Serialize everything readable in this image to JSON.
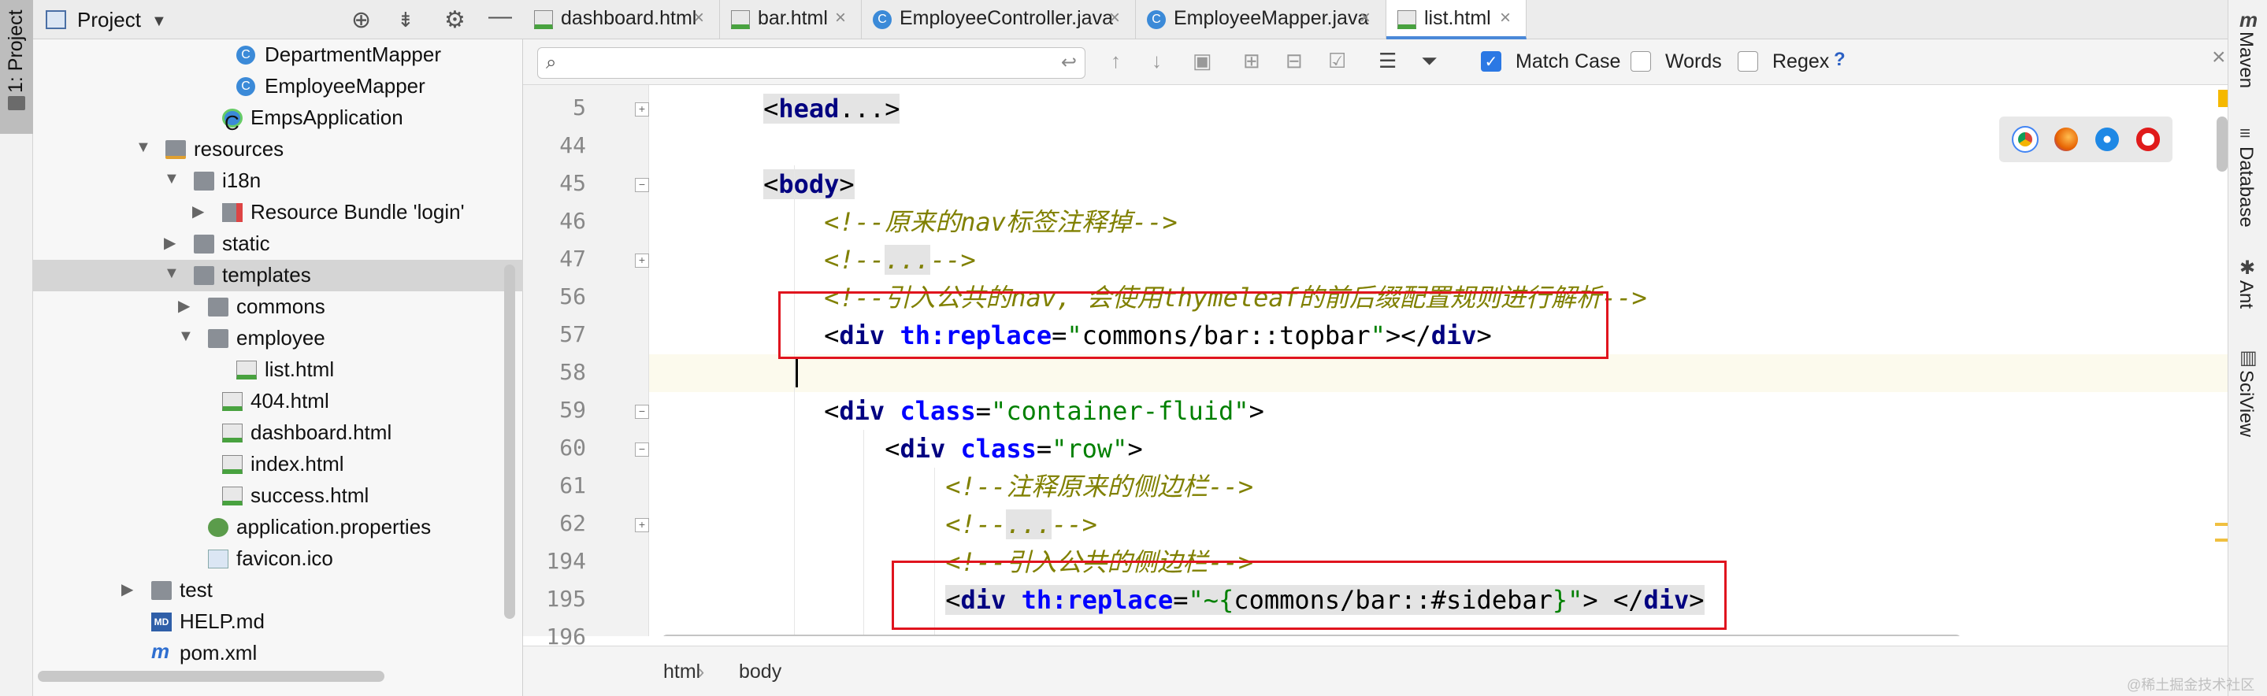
{
  "left_strip": {
    "label": "1: Project"
  },
  "project_panel": {
    "title": "Project",
    "tree": [
      {
        "label": "DepartmentMapper",
        "indent": 9,
        "icon": "class",
        "arrow": ""
      },
      {
        "label": "EmployeeMapper",
        "indent": 9,
        "icon": "class",
        "arrow": ""
      },
      {
        "label": "EmpsApplication",
        "indent": 8,
        "icon": "app",
        "arrow": ""
      },
      {
        "label": "resources",
        "indent": 4,
        "icon": "folder-res",
        "arrow": "▼"
      },
      {
        "label": "i18n",
        "indent": 6,
        "icon": "folder",
        "arrow": "▼"
      },
      {
        "label": "Resource Bundle 'login'",
        "indent": 8,
        "icon": "bundle",
        "arrow": "▶"
      },
      {
        "label": "static",
        "indent": 6,
        "icon": "folder",
        "arrow": "▶"
      },
      {
        "label": "templates",
        "indent": 6,
        "icon": "folder",
        "arrow": "▼",
        "selected": true
      },
      {
        "label": "commons",
        "indent": 7,
        "icon": "folder",
        "arrow": "▶"
      },
      {
        "label": "employee",
        "indent": 7,
        "icon": "folder",
        "arrow": "▼"
      },
      {
        "label": "list.html",
        "indent": 9,
        "icon": "html",
        "arrow": ""
      },
      {
        "label": "404.html",
        "indent": 8,
        "icon": "html",
        "arrow": ""
      },
      {
        "label": "dashboard.html",
        "indent": 8,
        "icon": "html",
        "arrow": ""
      },
      {
        "label": "index.html",
        "indent": 8,
        "icon": "html",
        "arrow": ""
      },
      {
        "label": "success.html",
        "indent": 8,
        "icon": "html",
        "arrow": ""
      },
      {
        "label": "application.properties",
        "indent": 7,
        "icon": "props",
        "arrow": ""
      },
      {
        "label": "favicon.ico",
        "indent": 7,
        "icon": "ico",
        "arrow": ""
      },
      {
        "label": "test",
        "indent": 3,
        "icon": "folder",
        "arrow": "▶"
      },
      {
        "label": "HELP.md",
        "indent": 3,
        "icon": "md",
        "arrow": ""
      },
      {
        "label": "pom.xml",
        "indent": 3,
        "icon": "maven",
        "arrow": ""
      }
    ]
  },
  "tabs": [
    {
      "label": "dashboard.html",
      "icon": "html",
      "active": false
    },
    {
      "label": "bar.html",
      "icon": "html",
      "active": false
    },
    {
      "label": "EmployeeController.java",
      "icon": "class",
      "active": false
    },
    {
      "label": "EmployeeMapper.java",
      "icon": "class",
      "active": false
    },
    {
      "label": "list.html",
      "icon": "html",
      "active": true
    }
  ],
  "search": {
    "value": "",
    "match_case_label": "Match Case",
    "match_case_checked": true,
    "words_label": "Words",
    "words_checked": false,
    "regex_label": "Regex",
    "regex_checked": false,
    "help_label": "?"
  },
  "editor": {
    "line_numbers": [
      "5",
      "44",
      "45",
      "46",
      "47",
      "56",
      "57",
      "58",
      "59",
      "60",
      "61",
      "62",
      "194",
      "195",
      "196"
    ],
    "lines": [
      {
        "line": "5",
        "html": [
          [
            "pln",
            "    "
          ],
          [
            "hl-pln",
            "<"
          ],
          [
            "hl-tag",
            "head"
          ],
          [
            "hl-pln",
            "...>"
          ]
        ]
      },
      {
        "line": "44",
        "html": []
      },
      {
        "line": "45",
        "html": [
          [
            "pln",
            "    "
          ],
          [
            "hl-pln",
            "<"
          ],
          [
            "hl-tag",
            "body"
          ],
          [
            "hl-pln",
            ">"
          ]
        ]
      },
      {
        "line": "46",
        "html": [
          [
            "pln",
            "        "
          ],
          [
            "cmt",
            "<!--原来的nav标签注释掉-->"
          ]
        ]
      },
      {
        "line": "47",
        "html": [
          [
            "pln",
            "        "
          ],
          [
            "cmt",
            "<!--"
          ],
          [
            "hl-cmt",
            "..."
          ],
          [
            "cmt",
            "-->"
          ]
        ]
      },
      {
        "line": "56",
        "html": [
          [
            "pln",
            "        "
          ],
          [
            "cmt",
            "<!--引入公共的nav, 会使用thymeleaf的前后缀配置规则进行解析-->"
          ]
        ]
      },
      {
        "line": "57",
        "html": [
          [
            "pln",
            "        "
          ],
          [
            "pln",
            "<"
          ],
          [
            "tag",
            "div"
          ],
          [
            "pln",
            " "
          ],
          [
            "attr",
            "th:replace"
          ],
          [
            "pln",
            "="
          ],
          [
            "str",
            "\""
          ],
          [
            "pln",
            "commons/bar::topbar"
          ],
          [
            "str",
            "\""
          ],
          [
            "pln",
            "></"
          ],
          [
            "tag",
            "div"
          ],
          [
            "pln",
            ">"
          ]
        ]
      },
      {
        "line": "58",
        "html": []
      },
      {
        "line": "59",
        "html": [
          [
            "pln",
            "        <"
          ],
          [
            "tag",
            "div"
          ],
          [
            "pln",
            " "
          ],
          [
            "attr",
            "class"
          ],
          [
            "pln",
            "="
          ],
          [
            "str",
            "\"container-fluid\""
          ],
          [
            "pln",
            ">"
          ]
        ]
      },
      {
        "line": "60",
        "html": [
          [
            "pln",
            "            <"
          ],
          [
            "tag",
            "div"
          ],
          [
            "pln",
            " "
          ],
          [
            "attr",
            "class"
          ],
          [
            "pln",
            "="
          ],
          [
            "str",
            "\"row\""
          ],
          [
            "pln",
            ">"
          ]
        ]
      },
      {
        "line": "61",
        "html": [
          [
            "pln",
            "                "
          ],
          [
            "cmt",
            "<!--注释原来的侧边栏-->"
          ]
        ]
      },
      {
        "line": "62",
        "html": [
          [
            "pln",
            "                "
          ],
          [
            "cmt",
            "<!--"
          ],
          [
            "hl-cmt",
            "..."
          ],
          [
            "cmt",
            "-->"
          ]
        ]
      },
      {
        "line": "194",
        "html": [
          [
            "pln",
            "                "
          ],
          [
            "cmt",
            "<!--引入公共的侧边栏-->"
          ]
        ]
      },
      {
        "line": "195",
        "html": [
          [
            "pln",
            "                "
          ],
          [
            "hl-pln",
            "<"
          ],
          [
            "hl-tag",
            "div"
          ],
          [
            "hl-pln",
            " "
          ],
          [
            "hl-attr",
            "th:replace"
          ],
          [
            "hl-pln",
            "="
          ],
          [
            "hl-str",
            "\"~{"
          ],
          [
            "hl-pln",
            "commons/bar::#sidebar"
          ],
          [
            "hl-str",
            "}\""
          ],
          [
            "hl-pln",
            "> </"
          ],
          [
            "hl-tag",
            "div"
          ],
          [
            "hl-pln",
            ">"
          ]
        ]
      },
      {
        "line": "196",
        "html": []
      }
    ],
    "current_line_index": 7
  },
  "breadcrumb": [
    "html",
    "body"
  ],
  "right_strip": [
    {
      "label": "Maven",
      "icon": "m"
    },
    {
      "label": "Database",
      "icon": "≡"
    },
    {
      "label": "Ant",
      "icon": "✱"
    },
    {
      "label": "SciView",
      "icon": "▥"
    }
  ],
  "watermark": "@稀土掘金技术社区",
  "colors": {
    "accent": "#4a88d8",
    "annotation_red": "#e0141e",
    "caret_line": "#fcfaed"
  }
}
